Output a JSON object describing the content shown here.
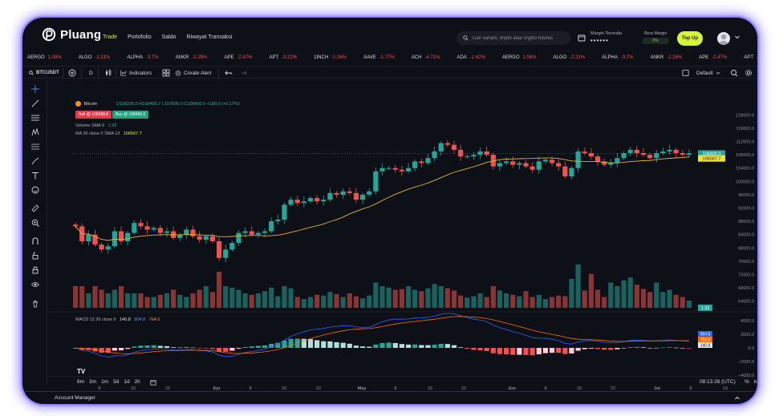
{
  "app": {
    "name": "Pluang"
  },
  "nav": {
    "items": [
      "Trade",
      "Portofolio",
      "Saldo",
      "Riwayat Transaksi"
    ],
    "active": 0
  },
  "search": {
    "placeholder": "Cari saham, kripto atau crypto futures"
  },
  "margin": {
    "label": "Margin Tersedia",
    "value": "••••••"
  },
  "reso_margin": {
    "label": "Reso Margin",
    "value": "0%"
  },
  "topup": {
    "label": "Top Up"
  },
  "ticker": [
    {
      "sym": "AERGO",
      "chg": "1.09%"
    },
    {
      "sym": "ALGO",
      "chg": "-2.31%"
    },
    {
      "sym": "ALPHA",
      "chg": "-3.7%"
    },
    {
      "sym": "ANKR",
      "chg": "-2.25%"
    },
    {
      "sym": "APE",
      "chg": "-2.47%"
    },
    {
      "sym": "APT",
      "chg": "-3.22%"
    },
    {
      "sym": "1INCH",
      "chg": "-1.06%"
    },
    {
      "sym": "AAVE",
      "chg": "-1.77%"
    },
    {
      "sym": "ACH",
      "chg": "-4.71%"
    },
    {
      "sym": "ADA",
      "chg": "-1.62%"
    },
    {
      "sym": "AERGO",
      "chg": "1.08%"
    },
    {
      "sym": "ALGO",
      "chg": "-2.31%"
    },
    {
      "sym": "ALPHA",
      "chg": "-3.7%"
    },
    {
      "sym": "ANKR",
      "chg": "-2.26%"
    },
    {
      "sym": "APE",
      "chg": "-2.47%"
    },
    {
      "sym": "APT",
      "chg": "-2.22%"
    }
  ],
  "toolbar": {
    "symbol": "BTCUSDT",
    "interval": "D",
    "indicators": "Indicators",
    "create_alert": "Create Alert",
    "layout": "Default"
  },
  "legend": {
    "name": "Bitcoin",
    "ohlc": "O108220.0 H108465.7 L107600.0 C108400.0 +180.0 (+0.17%)",
    "sell": "Sell @ 108380.0",
    "qty": "168",
    "buy": "Buy @ 108400.0",
    "volume": "Volume SMA 9",
    "volume_val": "1.33",
    "ma": "MA 20 close 0 SMA 13",
    "ma_val": "106567.7",
    "macd": "MACD 12 26 close 9",
    "macd_vals": [
      "140.8",
      "904.8",
      "764.0"
    ]
  },
  "price_axis": {
    "ticks": [
      "120000.0",
      "116000.0",
      "112000.0",
      "108000.0",
      "104000.0",
      "100000.0",
      "96000.0",
      "92000.0",
      "88000.0",
      "84000.0",
      "80000.0",
      "76000.0",
      "72000.0",
      "68000.0",
      "64000.0"
    ],
    "last_price": "108400.0",
    "ma_price": "106567.7",
    "volume_label": "1.33"
  },
  "macd_axis": {
    "ticks": [
      "4000.0",
      "2000.0",
      "0.0",
      "−2000.0",
      "−4000.0"
    ],
    "labels": [
      "904.8",
      "764.0",
      "140.8"
    ]
  },
  "time_axis": [
    "8",
    "15",
    "22",
    "Apr",
    "8",
    "15",
    "22",
    "May",
    "8",
    "15",
    "22",
    "Jun",
    "8",
    "15",
    "22",
    "Jul",
    "8",
    "15"
  ],
  "ranges": [
    "6m",
    "3m",
    "1m",
    "5d",
    "1d",
    "2h"
  ],
  "clock": "08:13:28 (UTC)",
  "scale_opts": [
    "%",
    "log",
    "auto"
  ],
  "account_manager": "Account Manager",
  "colors": {
    "up": "#26a69a",
    "down": "#ef5350",
    "accent": "#d8f43a",
    "ma": "#e2b33c"
  },
  "chart_data": {
    "type": "candlestick",
    "title": "Bitcoin",
    "series": [
      {
        "name": "price",
        "values": [
          86500,
          82000,
          84000,
          81000,
          79500,
          80500,
          85000,
          82000,
          84500,
          87500,
          86500,
          85500,
          86000,
          84500,
          85000,
          83000,
          84000,
          85500,
          83500,
          82500,
          83500,
          82000,
          77000,
          79500,
          81500,
          84500,
          85000,
          84000,
          84500,
          85000,
          88000,
          88500,
          93000,
          94500,
          93500,
          94000,
          95000,
          94000,
          94500,
          96500,
          96000,
          97000,
          96500,
          94500,
          96000,
          97000,
          103000,
          104000,
          104000,
          103500,
          103000,
          104000,
          106000,
          105500,
          107000,
          109000,
          111500,
          111000,
          109500,
          107500,
          107500,
          108000,
          109000,
          108000,
          104500,
          105500,
          106000,
          105000,
          105500,
          104500,
          103500,
          106000,
          106500,
          105500,
          104500,
          101500,
          104000,
          109000,
          108500,
          107500,
          106000,
          105000,
          105500,
          107000,
          108500,
          109500,
          108500,
          108000,
          107000,
          108500,
          109000,
          109500,
          108500,
          108000,
          108400
        ]
      },
      {
        "name": "volume",
        "values": [
          3,
          3,
          2,
          3,
          2.5,
          2,
          2.5,
          3,
          2,
          2,
          2,
          1.5,
          1.5,
          1.8,
          2,
          2.5,
          1.8,
          1.5,
          2,
          2.5,
          3,
          2.2,
          5,
          3,
          2.8,
          2.5,
          2,
          1.8,
          2,
          2.3,
          2.8,
          1.6,
          3,
          2.7,
          1.5,
          1.2,
          1.5,
          1.8,
          1.7,
          2.2,
          1.9,
          1.5,
          2,
          1.6,
          1.3,
          1.7,
          3.5,
          3,
          2.8,
          2.5,
          2.6,
          3,
          2.5,
          2.3,
          2.7,
          3.3,
          3,
          2.7,
          2.4,
          1.7,
          1.4,
          1.6,
          2,
          1.5,
          3,
          2.4,
          2,
          1.8,
          1.6,
          2.3,
          1.5,
          1.8,
          1.2,
          1.5,
          1.7,
          1.6,
          4,
          6,
          2.4,
          4.7,
          2.5,
          1.5,
          3.5,
          3,
          3.8,
          4.2,
          3.2,
          2.6,
          2.2,
          3.5,
          2.2,
          2.5,
          1.8,
          1.5,
          1
        ]
      }
    ],
    "ylim": [
      62000,
      122000
    ]
  }
}
